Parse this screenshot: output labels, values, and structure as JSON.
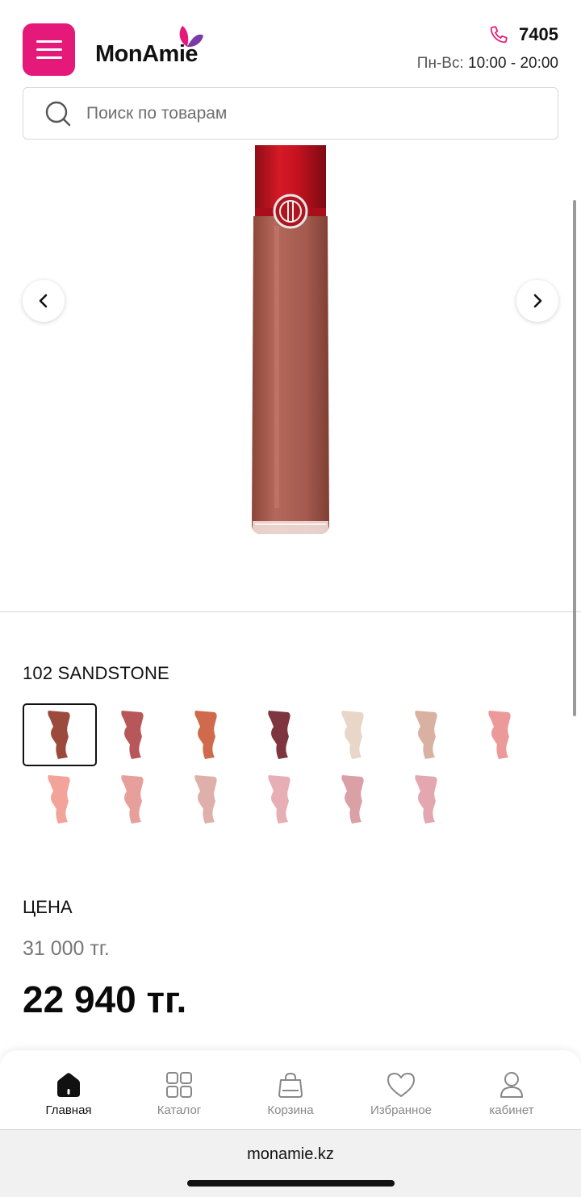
{
  "header": {
    "brand": "MonAmie",
    "phone": "7405",
    "hours_label": "Пн-Вс:",
    "hours_value": "10:00 - 20:00"
  },
  "search": {
    "placeholder": "Поиск по товарам"
  },
  "product": {
    "shade_name": "102 SANDSTONE",
    "swatch_colors": [
      "#9b4a3c",
      "#b8575a",
      "#cf6a4c",
      "#7e3540",
      "#e8d6c8",
      "#d9b1a3",
      "#eb9a99",
      "#f2a49a",
      "#e79f9b",
      "#dfb0ab",
      "#e7aeb5",
      "#d9a0a6",
      "#e4a7b0"
    ],
    "selected_swatch": 0,
    "price_label": "ЦЕНА",
    "old_price": "31 000 тг.",
    "new_price": "22 940 тг."
  },
  "colors": {
    "brand_pink": "#e5197a",
    "cap_red": "#c4121f",
    "tube_body": "#a55a4f"
  },
  "bottom_nav": [
    {
      "label": "Главная",
      "icon": "home-icon",
      "active": true
    },
    {
      "label": "Каталог",
      "icon": "grid-icon",
      "active": false
    },
    {
      "label": "Корзина",
      "icon": "bag-icon",
      "active": false
    },
    {
      "label": "Избранное",
      "icon": "heart-icon",
      "active": false
    },
    {
      "label": "кабинет",
      "icon": "user-icon",
      "active": false
    }
  ],
  "browser": {
    "url": "monamie.kz"
  }
}
